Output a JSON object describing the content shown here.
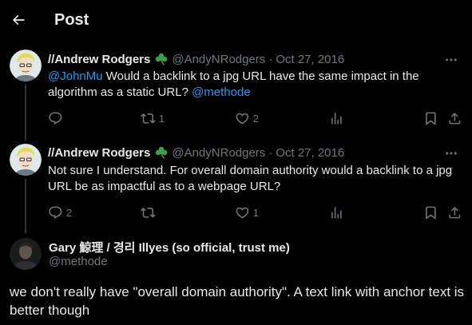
{
  "header": {
    "title": "Post"
  },
  "tweets": [
    {
      "display_name": "//Andrew Rodgers",
      "badge": "☘️",
      "handle": "@AndyNRodgers",
      "date": "Oct 27, 2016",
      "mention_1": "@JohnMu",
      "text": " Would a backlink to a jpg URL have the same impact in the algorithm as a static URL? ",
      "mention_2": "@methode",
      "reply_count": "",
      "retweet_count": "1",
      "like_count": "2"
    },
    {
      "display_name": "//Andrew Rodgers",
      "badge": "☘️",
      "handle": "@AndyNRodgers",
      "date": "Oct 27, 2016",
      "text": "Not sure I understand. For overall domain authority would a backlink to a jpg URL be as impactful as to a webpage URL?",
      "reply_count": "2",
      "retweet_count": "",
      "like_count": "1"
    }
  ],
  "main_post": {
    "display_name": "Gary 鯨理 / 경리 Illyes (so official, trust me)",
    "handle": "@methode",
    "text": "we don't really have \"overall domain authority\". A text link with anchor text is better though"
  },
  "colors": {
    "background": "#000000",
    "text": "#e7e9ea",
    "muted": "#71767b",
    "link": "#1d9bf0",
    "badge": "#3aa04a"
  },
  "icons": [
    "back-arrow-icon",
    "shamrock-icon",
    "more-icon",
    "reply-icon",
    "retweet-icon",
    "like-icon",
    "views-icon",
    "bookmark-icon",
    "share-icon"
  ]
}
